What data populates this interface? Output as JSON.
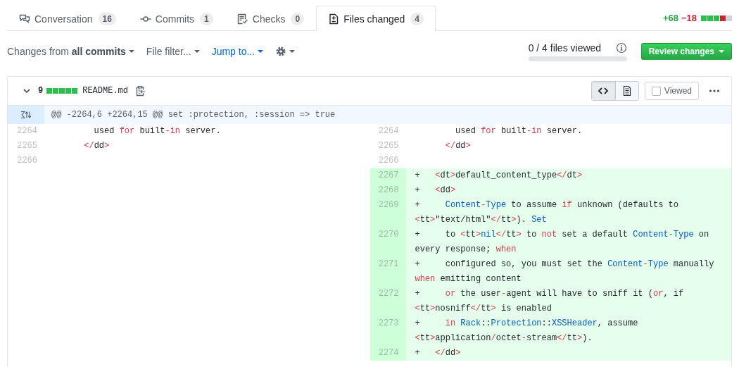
{
  "tabs": [
    {
      "label": "Conversation",
      "counter": "16",
      "selected": false
    },
    {
      "label": "Commits",
      "counter": "1",
      "selected": false
    },
    {
      "label": "Checks",
      "counter": "0",
      "selected": false
    },
    {
      "label": "Files changed",
      "counter": "4",
      "selected": true
    }
  ],
  "diffstat": {
    "additions": "+68",
    "deletions": "−18",
    "blocks": [
      {
        "kind": "added"
      },
      {
        "kind": "added"
      },
      {
        "kind": "added"
      },
      {
        "kind": "deleted"
      },
      {
        "kind": "neutral"
      }
    ]
  },
  "toolbar": {
    "menus": [
      {
        "label": "Changes from **all commits**",
        "hovered": false
      },
      {
        "label": "File filter...",
        "hovered": false
      },
      {
        "label": "Jump to...",
        "hovered": true
      }
    ],
    "files_viewed": {
      "text": "0 / 4 files viewed",
      "level": 0
    },
    "review_button": "Review changes"
  },
  "file": {
    "expanded": true,
    "additions": "9",
    "blocks": [
      {
        "kind": "added"
      },
      {
        "kind": "added"
      },
      {
        "kind": "added"
      },
      {
        "kind": "added"
      },
      {
        "kind": "added"
      }
    ],
    "name": "README.md",
    "views": [
      {
        "kind": "code",
        "selected": true
      },
      {
        "kind": "rich",
        "selected": false
      }
    ],
    "viewed": {
      "label": "Viewed",
      "checked": false
    },
    "hunk": "@@ -2264,6 +2264,15 @@ set :protection, :session => true",
    "rows": [
      {
        "left": {
          "number": "2264",
          "tokens": [
            {
              "text": "        used ",
              "kind": "plain"
            },
            {
              "text": "for",
              "kind": "keyword"
            },
            {
              "text": " built",
              "kind": "plain"
            },
            {
              "text": "-in",
              "kind": "keyword"
            },
            {
              "text": " server.",
              "kind": "plain"
            }
          ]
        },
        "right": {
          "kind": "context",
          "number": "2264",
          "tokens": [
            {
              "text": "        used ",
              "kind": "plain"
            },
            {
              "text": "for",
              "kind": "keyword"
            },
            {
              "text": " built",
              "kind": "plain"
            },
            {
              "text": "-in",
              "kind": "keyword"
            },
            {
              "text": " server.",
              "kind": "plain"
            }
          ]
        }
      },
      {
        "left": {
          "number": "2265",
          "tokens": [
            {
              "text": "      </",
              "kind": "keyword"
            },
            {
              "text": "dd",
              "kind": "plain"
            },
            {
              "text": ">",
              "kind": "keyword"
            }
          ]
        },
        "right": {
          "kind": "context",
          "number": "2265",
          "tokens": [
            {
              "text": "      </",
              "kind": "keyword"
            },
            {
              "text": "dd",
              "kind": "plain"
            },
            {
              "text": ">",
              "kind": "keyword"
            }
          ]
        }
      },
      {
        "left": {
          "number": "2266"
        },
        "right": {
          "kind": "context",
          "number": "2266"
        }
      },
      {
        "right": {
          "kind": "added",
          "number": "2267",
          "tokens": [
            {
              "text": "+   ",
              "kind": "plain"
            },
            {
              "text": "<",
              "kind": "keyword"
            },
            {
              "text": "dt",
              "kind": "plain"
            },
            {
              "text": ">",
              "kind": "keyword"
            },
            {
              "text": "default_content_type",
              "kind": "plain"
            },
            {
              "text": "</",
              "kind": "keyword"
            },
            {
              "text": "dt",
              "kind": "plain"
            },
            {
              "text": ">",
              "kind": "keyword"
            }
          ]
        }
      },
      {
        "right": {
          "kind": "added",
          "number": "2268",
          "tokens": [
            {
              "text": "+   ",
              "kind": "plain"
            },
            {
              "text": "<",
              "kind": "keyword"
            },
            {
              "text": "dd",
              "kind": "plain"
            },
            {
              "text": ">",
              "kind": "keyword"
            }
          ]
        }
      },
      {
        "right": {
          "kind": "added",
          "number": "2269",
          "tokens": [
            {
              "text": "+     ",
              "kind": "plain"
            },
            {
              "text": "Content",
              "kind": "constant"
            },
            {
              "text": "-",
              "kind": "keyword"
            },
            {
              "text": "Type",
              "kind": "constant"
            },
            {
              "text": " to assume ",
              "kind": "plain"
            },
            {
              "text": "if",
              "kind": "keyword"
            },
            {
              "text": " unknown (defaults to ",
              "kind": "plain"
            },
            {
              "text": "<",
              "kind": "keyword"
            },
            {
              "text": "tt",
              "kind": "plain"
            },
            {
              "text": ">",
              "kind": "keyword"
            },
            {
              "text": "\"text/html\"",
              "kind": "plain"
            },
            {
              "text": "</",
              "kind": "keyword"
            },
            {
              "text": "tt",
              "kind": "plain"
            },
            {
              "text": ">",
              "kind": "keyword"
            },
            {
              "text": "). ",
              "kind": "plain"
            },
            {
              "text": "Set",
              "kind": "constant"
            }
          ]
        }
      },
      {
        "right": {
          "kind": "added",
          "number": "2270",
          "tokens": [
            {
              "text": "+     to ",
              "kind": "plain"
            },
            {
              "text": "<",
              "kind": "keyword"
            },
            {
              "text": "tt",
              "kind": "plain"
            },
            {
              "text": ">",
              "kind": "keyword"
            },
            {
              "text": "nil",
              "kind": "constant"
            },
            {
              "text": "</",
              "kind": "keyword"
            },
            {
              "text": "tt",
              "kind": "plain"
            },
            {
              "text": ">",
              "kind": "keyword"
            },
            {
              "text": " to ",
              "kind": "plain"
            },
            {
              "text": "not",
              "kind": "keyword"
            },
            {
              "text": " set a default ",
              "kind": "plain"
            },
            {
              "text": "Content",
              "kind": "constant"
            },
            {
              "text": "-",
              "kind": "keyword"
            },
            {
              "text": "Type",
              "kind": "constant"
            },
            {
              "text": " on every response; ",
              "kind": "plain"
            },
            {
              "text": "when",
              "kind": "keyword"
            }
          ]
        }
      },
      {
        "right": {
          "kind": "added",
          "number": "2271",
          "tokens": [
            {
              "text": "+     configured so, you must set the ",
              "kind": "plain"
            },
            {
              "text": "Content",
              "kind": "constant"
            },
            {
              "text": "-",
              "kind": "keyword"
            },
            {
              "text": "Type",
              "kind": "constant"
            },
            {
              "text": " manually ",
              "kind": "plain"
            },
            {
              "text": "when",
              "kind": "keyword"
            },
            {
              "text": " emitting content",
              "kind": "plain"
            }
          ]
        }
      },
      {
        "right": {
          "kind": "added",
          "number": "2272",
          "tokens": [
            {
              "text": "+     ",
              "kind": "plain"
            },
            {
              "text": "or",
              "kind": "keyword"
            },
            {
              "text": " the user",
              "kind": "plain"
            },
            {
              "text": "-",
              "kind": "keyword"
            },
            {
              "text": "agent will have to sniff it (",
              "kind": "plain"
            },
            {
              "text": "or",
              "kind": "keyword"
            },
            {
              "text": ", if ",
              "kind": "plain"
            },
            {
              "text": "<",
              "kind": "keyword"
            },
            {
              "text": "tt",
              "kind": "plain"
            },
            {
              "text": ">",
              "kind": "keyword"
            },
            {
              "text": "nosniff",
              "kind": "plain"
            },
            {
              "text": "</",
              "kind": "keyword"
            },
            {
              "text": "tt",
              "kind": "plain"
            },
            {
              "text": ">",
              "kind": "keyword"
            },
            {
              "text": " is enabled",
              "kind": "plain"
            }
          ]
        }
      },
      {
        "right": {
          "kind": "added",
          "number": "2273",
          "tokens": [
            {
              "text": "+     ",
              "kind": "plain"
            },
            {
              "text": "in ",
              "kind": "keyword"
            },
            {
              "text": "Rack",
              "kind": "constant"
            },
            {
              "text": "::",
              "kind": "plain"
            },
            {
              "text": "Protection",
              "kind": "constant"
            },
            {
              "text": "::",
              "kind": "plain"
            },
            {
              "text": "XSSHeader",
              "kind": "constant"
            },
            {
              "text": ", assume ",
              "kind": "plain"
            },
            {
              "text": "<",
              "kind": "keyword"
            },
            {
              "text": "tt",
              "kind": "plain"
            },
            {
              "text": ">",
              "kind": "keyword"
            },
            {
              "text": "application",
              "kind": "plain"
            },
            {
              "text": "/",
              "kind": "keyword"
            },
            {
              "text": "octet",
              "kind": "plain"
            },
            {
              "text": "-",
              "kind": "keyword"
            },
            {
              "text": "stream",
              "kind": "plain"
            },
            {
              "text": "</",
              "kind": "keyword"
            },
            {
              "text": "tt",
              "kind": "plain"
            },
            {
              "text": ">",
              "kind": "keyword"
            },
            {
              "text": ").",
              "kind": "plain"
            }
          ]
        }
      },
      {
        "right": {
          "kind": "added",
          "number": "2274",
          "tokens": [
            {
              "text": "+   ",
              "kind": "plain"
            },
            {
              "text": "</",
              "kind": "keyword"
            },
            {
              "text": "dd",
              "kind": "plain"
            },
            {
              "text": ">",
              "kind": "keyword"
            }
          ]
        }
      }
    ]
  }
}
